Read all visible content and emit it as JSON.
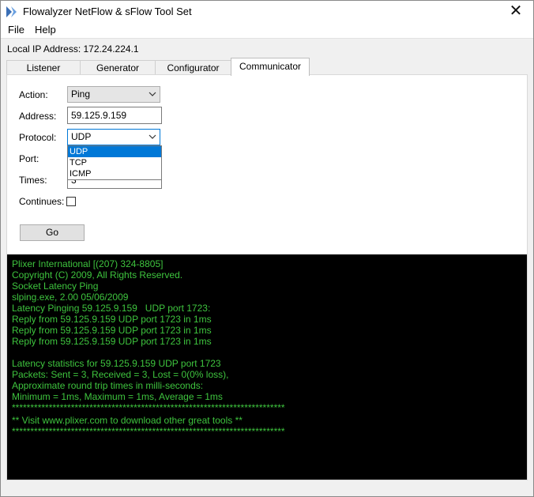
{
  "window": {
    "title": "Flowalyzer NetFlow & sFlow Tool Set",
    "close_glyph": "✕"
  },
  "menu": [
    {
      "label": "File"
    },
    {
      "label": "Help"
    }
  ],
  "local_ip": "Local IP Address: 172.24.224.1",
  "tabs": [
    {
      "label": "Listener"
    },
    {
      "label": "Generator"
    },
    {
      "label": "Configurator"
    },
    {
      "label": "Communicator",
      "active": true
    }
  ],
  "form": {
    "action_label": "Action:",
    "action_value": "Ping",
    "address_label": "Address:",
    "address_value": "59.125.9.159",
    "protocol_label": "Protocol:",
    "protocol_value": "UDP",
    "protocol_options": [
      "UDP",
      "TCP",
      "ICMP"
    ],
    "port_label": "Port:",
    "times_label": "Times:",
    "times_value": "3",
    "continues_label": "Continues:",
    "go_label": "Go"
  },
  "console": {
    "lines": [
      "Plixer International [(207) 324-8805]",
      "Copyright (C) 2009, All Rights Reserved.",
      "Socket Latency Ping",
      "slping.exe, 2.00 05/06/2009",
      "Latency Pinging 59.125.9.159   UDP port 1723:",
      "Reply from 59.125.9.159 UDP port 1723 in 1ms",
      "Reply from 59.125.9.159 UDP port 1723 in 1ms",
      "Reply from 59.125.9.159 UDP port 1723 in 1ms",
      "",
      "Latency statistics for 59.125.9.159 UDP port 1723",
      "Packets: Sent = 3, Received = 3, Lost = 0(0% loss),",
      "Approximate round trip times in milli-seconds:",
      "Minimum = 1ms, Maximum = 1ms, Average = 1ms",
      "**************************************************************************",
      "** Visit www.plixer.com to download other great tools **",
      "**************************************************************************"
    ]
  },
  "colors": {
    "console_bg": "#000000",
    "console_text": "#3ec43e",
    "selection": "#0078d7",
    "focus_border": "#0078d7"
  },
  "icons": {
    "app": "flowalyzer-app-icon",
    "close": "close-icon",
    "dropdown": "chevron-down-icon",
    "checkbox": "checkbox-icon"
  }
}
